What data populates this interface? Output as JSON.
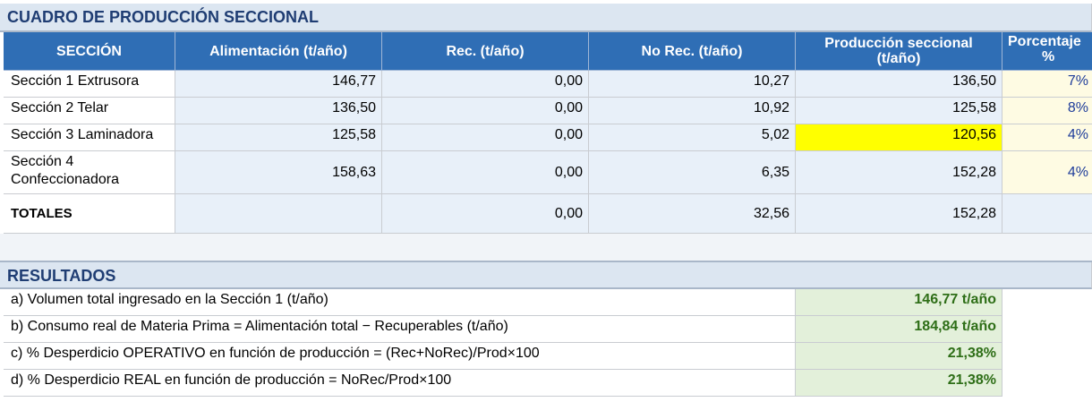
{
  "sheet": {
    "title": "CUADRO DE PRODUCCIÓN SECCIONAL",
    "headers": {
      "seccion": "SECCIÓN",
      "alimentacion": "Alimentación (t/año)",
      "rec": "Rec. (t/año)",
      "norec": "No Rec. (t/año)",
      "produccion_l1": "Producción seccional",
      "produccion_l2": "(t/año)",
      "porcentaje_l1": "Porcentaje",
      "porcentaje_l2": "%"
    },
    "rows": [
      {
        "seccion": "Sección 1 Extrusora",
        "alimentacion": "146,77",
        "rec": "0,00",
        "norec": "10,27",
        "produccion": "136,50",
        "porcentaje": "7%"
      },
      {
        "seccion": "Sección 2 Telar",
        "alimentacion": "136,50",
        "rec": "0,00",
        "norec": "10,92",
        "produccion": "125,58",
        "porcentaje": "8%"
      },
      {
        "seccion": "Sección 3 Laminadora",
        "alimentacion": "125,58",
        "rec": "0,00",
        "norec": "5,02",
        "produccion": "120,56",
        "porcentaje": "4%"
      },
      {
        "seccion_l1": "Sección 4",
        "seccion_l2": "Confeccionadora",
        "alimentacion": "158,63",
        "rec": "0,00",
        "norec": "6,35",
        "produccion": "152,28",
        "porcentaje": "4%"
      }
    ],
    "totals": {
      "label": "TOTALES",
      "rec": "0,00",
      "norec": "32,56",
      "produccion": "152,28"
    },
    "highlight_color": "#ffff00",
    "results": {
      "title": "RESULTADOS",
      "items": [
        {
          "label": "a) Volumen total ingresado en la Sección 1 (t/año)",
          "value": "146,77 t/año"
        },
        {
          "label": "b) Consumo real de Materia Prima  = Alimentación total − Recuperables (t/año)",
          "value": "184,84 t/año"
        },
        {
          "label": "c) % Desperdicio OPERATIVO en función de producción  = (Rec+NoRec)/Prod×100",
          "value": "21,38%"
        },
        {
          "label": "d) % Desperdicio REAL en función de producción  = NoRec/Prod×100",
          "value": "21,38%"
        }
      ]
    }
  }
}
